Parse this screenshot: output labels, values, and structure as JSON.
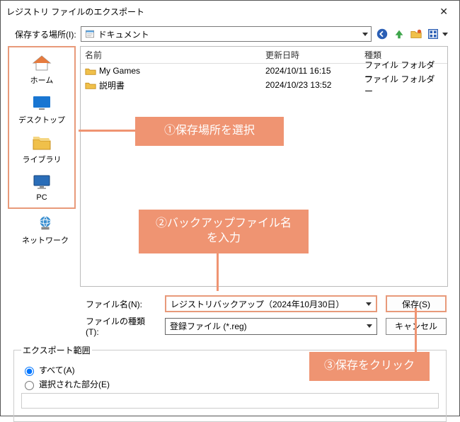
{
  "title": "レジストリ ファイルのエクスポート",
  "toolbar": {
    "save_in_label": "保存する場所(I):",
    "path_text": "ドキュメント"
  },
  "places": [
    {
      "label": "ホーム"
    },
    {
      "label": "デスクトップ"
    },
    {
      "label": "ライブラリ"
    },
    {
      "label": "PC"
    },
    {
      "label": "ネットワーク"
    }
  ],
  "columns": {
    "name": "名前",
    "date": "更新日時",
    "type": "種類"
  },
  "rows": [
    {
      "name": "My Games",
      "date": "2024/10/11 16:15",
      "type": "ファイル フォルダー"
    },
    {
      "name": "説明書",
      "date": "2024/10/23 13:52",
      "type": "ファイル フォルダー"
    }
  ],
  "fields": {
    "filename_label": "ファイル名(N):",
    "filename_value": "レジストリバックアップ（2024年10月30日）",
    "filetype_label": "ファイルの種類(T):",
    "filetype_value": "登録ファイル (*.reg)"
  },
  "buttons": {
    "save": "保存(S)",
    "cancel": "キャンセル"
  },
  "range": {
    "legend": "エクスポート範囲",
    "all_label": "すべて(A)",
    "selected_label": "選択された部分(E)"
  },
  "callouts": {
    "c1": "①保存場所を選択",
    "c2": "②バックアップファイル名\nを入力",
    "c3": "③保存をクリック"
  }
}
